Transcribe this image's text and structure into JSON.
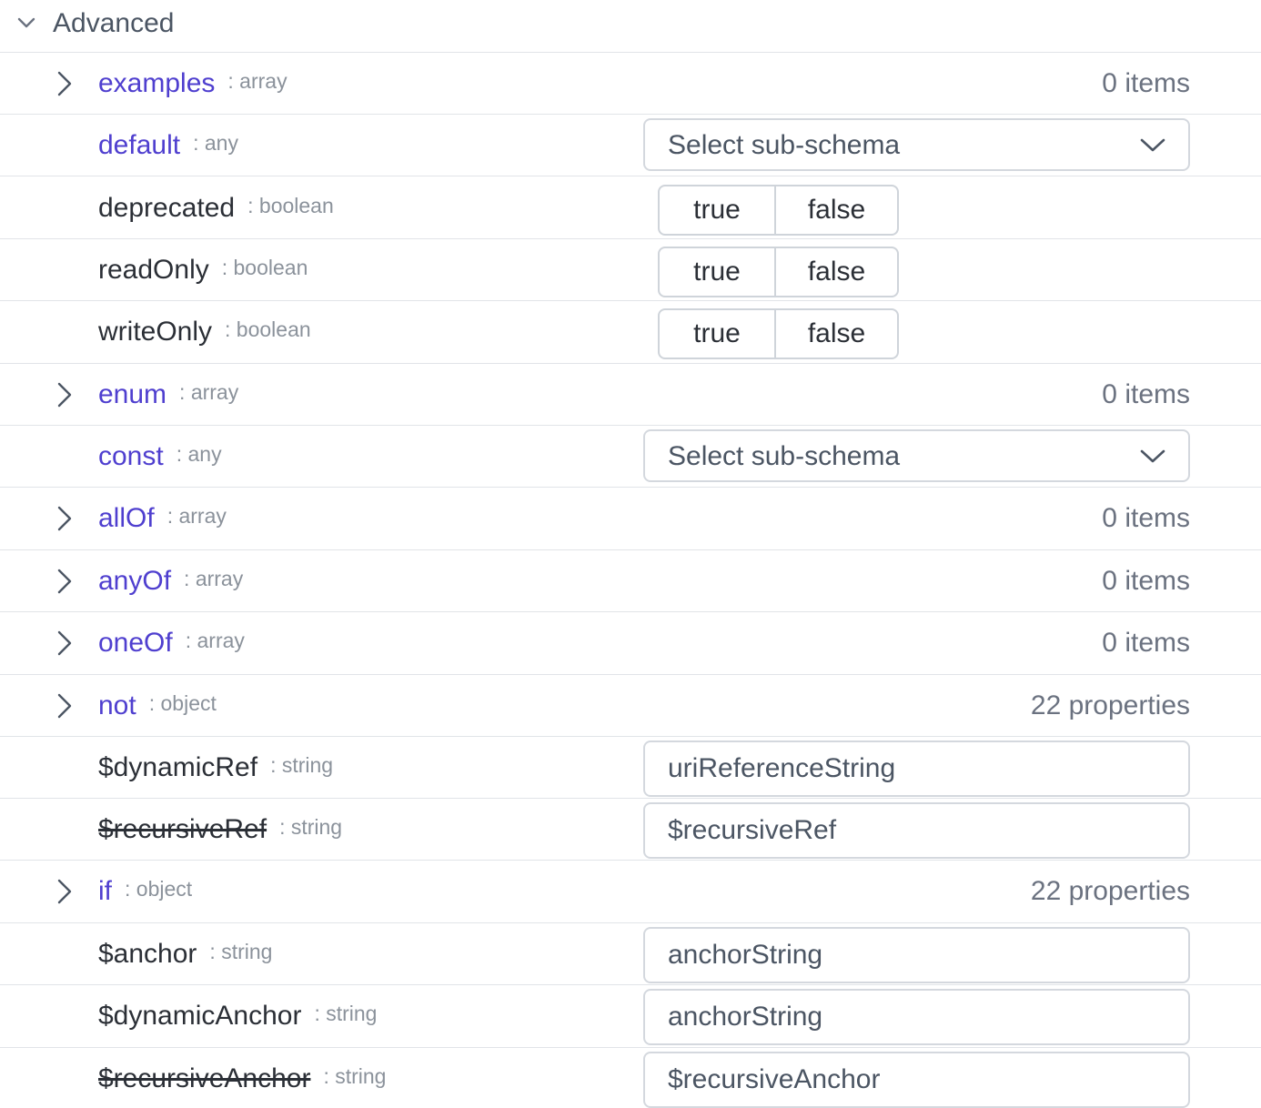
{
  "section": {
    "title": "Advanced"
  },
  "rows": [
    {
      "name": "examples",
      "type": ": array",
      "count": "0 items"
    },
    {
      "name": "default",
      "type": ": any",
      "select": "Select sub-schema"
    },
    {
      "name": "deprecated",
      "type": ": boolean",
      "true_label": "true",
      "false_label": "false"
    },
    {
      "name": "readOnly",
      "type": ": boolean",
      "true_label": "true",
      "false_label": "false"
    },
    {
      "name": "writeOnly",
      "type": ": boolean",
      "true_label": "true",
      "false_label": "false"
    },
    {
      "name": "enum",
      "type": ": array",
      "count": "0 items"
    },
    {
      "name": "const",
      "type": ": any",
      "select": "Select sub-schema"
    },
    {
      "name": "allOf",
      "type": ": array",
      "count": "0 items"
    },
    {
      "name": "anyOf",
      "type": ": array",
      "count": "0 items"
    },
    {
      "name": "oneOf",
      "type": ": array",
      "count": "0 items"
    },
    {
      "name": "not",
      "type": ": object",
      "count": "22 properties"
    },
    {
      "name": "$dynamicRef",
      "type": ": string",
      "placeholder": "uriReferenceString"
    },
    {
      "name": "$recursiveRef",
      "type": ": string",
      "placeholder": "$recursiveRef"
    },
    {
      "name": "if",
      "type": ": object",
      "count": "22 properties"
    },
    {
      "name": "$anchor",
      "type": ": string",
      "placeholder": "anchorString"
    },
    {
      "name": "$dynamicAnchor",
      "type": ": string",
      "placeholder": "anchorString"
    },
    {
      "name": "$recursiveAnchor",
      "type": ": string",
      "placeholder": "$recursiveAnchor"
    }
  ],
  "colors": {
    "link": "#4f3fcf",
    "text": "#2b2f36",
    "muted": "#8b929b",
    "border": "#e1e4e8"
  },
  "icons": {
    "section": "chevron-down-icon",
    "row": "chevron-right-icon",
    "select": "caret-down-icon"
  }
}
